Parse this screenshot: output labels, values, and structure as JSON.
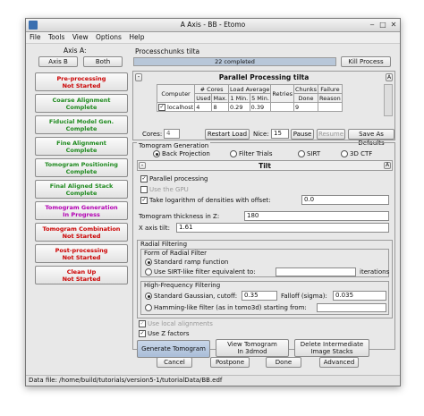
{
  "window": {
    "title": "A Axis - BB - Etomo"
  },
  "menu": [
    "File",
    "Tools",
    "View",
    "Options",
    "Help"
  ],
  "axis_label": "Axis A:",
  "axis_buttons": {
    "axis_b": "Axis B",
    "both": "Both"
  },
  "process": {
    "name": "Processchunks tilta",
    "progress_text": "22 completed",
    "progress_fraction": 1.0,
    "kill_button": "Kill Process"
  },
  "steps": [
    {
      "line1": "Pre-processing",
      "line2": "Not Started",
      "color": "red"
    },
    {
      "line1": "Coarse Alignment",
      "line2": "Complete",
      "color": "green"
    },
    {
      "line1": "Fiducial Model Gen.",
      "line2": "Complete",
      "color": "green"
    },
    {
      "line1": "Fine Alignment",
      "line2": "Complete",
      "color": "green"
    },
    {
      "line1": "Tomogram Positioning",
      "line2": "Complete",
      "color": "green"
    },
    {
      "line1": "Final Aligned Stack",
      "line2": "Complete",
      "color": "green"
    },
    {
      "line1": "Tomogram Generation",
      "line2": "In Progress",
      "color": "magenta"
    },
    {
      "line1": "Tomogram Combination",
      "line2": "Not Started",
      "color": "red"
    },
    {
      "line1": "Post-processing",
      "line2": "Not Started",
      "color": "red"
    },
    {
      "line1": "Clean Up",
      "line2": "Not Started",
      "color": "red"
    }
  ],
  "parallel": {
    "title": "Parallel Processing tilta",
    "headers_top": [
      "Computer",
      "# Cores",
      "Load Average",
      "Retries",
      "Chunks",
      "Failure"
    ],
    "headers_bottom": [
      "",
      "Used",
      "Max.",
      "1 Min.",
      "5 Min.",
      "",
      "Done",
      "Reason"
    ],
    "row": {
      "computer": "localhost",
      "used": "4",
      "max": "8",
      "load1": "0.29",
      "load5": "0.39",
      "retries": "",
      "done": "9",
      "reason": ""
    },
    "cores_label": "Cores:",
    "cores_value": "4",
    "restart_load": "Restart Load",
    "nice_label": "Nice:",
    "nice_value": "15",
    "pause": "Pause",
    "resume": "Resume",
    "save_defaults": "Save As Defaults"
  },
  "tomogen": {
    "section_title": "Tomogram Generation",
    "methods": [
      "Back Projection",
      "Filter Trials",
      "SIRT",
      "3D CTF"
    ],
    "tilt_title": "Tilt",
    "parallel_processing": "Parallel processing",
    "use_gpu": "Use the GPU",
    "take_log": "Take logarithm of densities with offset:",
    "log_offset": "0.0",
    "thickness_label": "Tomogram thickness in Z:",
    "thickness_value": "180",
    "x_axis_tilt_label": "X axis tilt:",
    "x_axis_tilt_value": "1.61",
    "radial_title": "Radial Filtering",
    "form_title": "Form of Radial Filter",
    "standard_ramp": "Standard ramp function",
    "sirt_like": "Use SIRT-like filter equivalent to:",
    "iterations": "iterations",
    "hf_title": "High-Frequency Filtering",
    "std_gaussian": "Standard Gaussian, cutoff:",
    "cutoff_value": "0.35",
    "falloff_label": "Falloff (sigma):",
    "falloff_value": "0.035",
    "hamming": "Hamming-like filter (as in tomo3d) starting from:",
    "use_local": "Use local alignments",
    "use_z": "Use Z factors",
    "generate": "Generate Tomogram",
    "view_line1": "View Tomogram",
    "view_line2": "In 3dmod",
    "delete_line1": "Delete Intermediate",
    "delete_line2": "Image Stacks"
  },
  "bottom_buttons": {
    "cancel": "Cancel",
    "postpone": "Postpone",
    "done": "Done",
    "advanced": "Advanced"
  },
  "status": "Data file: /home/build/tutorials/version5-1/tutorialData/BB.edf"
}
